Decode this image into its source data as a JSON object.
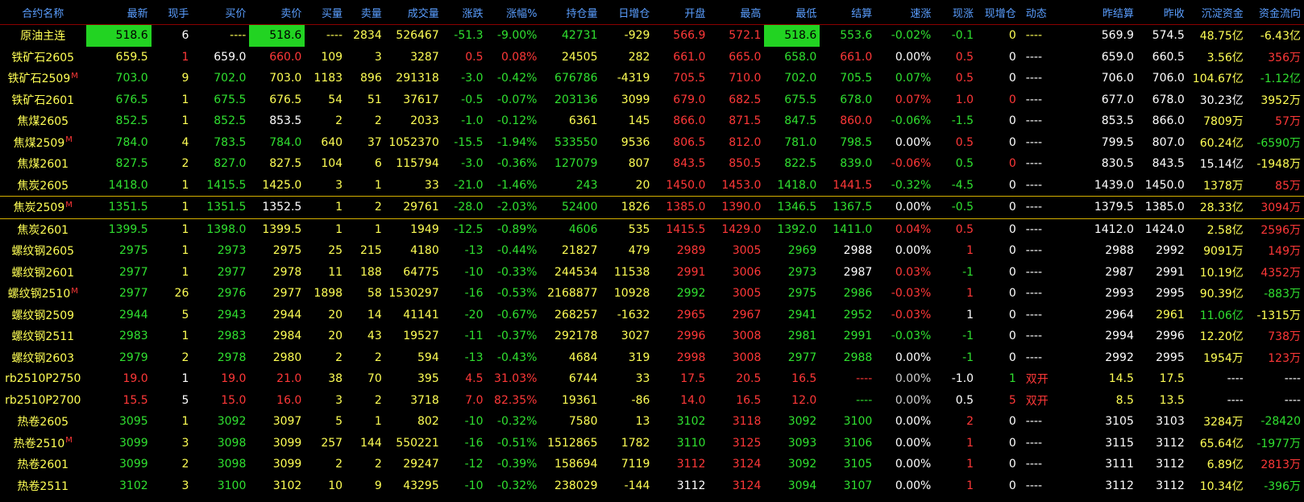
{
  "colors": {
    "header": "#5a9eff",
    "yellow": "#ffff55",
    "red": "#ff3838",
    "green": "#30e030",
    "white": "#ffffff",
    "highlight": "#22d322",
    "selected_border": "#d4b000"
  },
  "headers": [
    "合约名称",
    "最新",
    "现手",
    "买价",
    "卖价",
    "买量",
    "卖量",
    "成交量",
    "涨跌",
    "涨幅%",
    "持仓量",
    "日增仓",
    "开盘",
    "最高",
    "最低",
    "结算",
    "速涨",
    "现涨",
    "现增仓",
    "动态",
    "昨结算",
    "昨收",
    "沉淀资金",
    "资金流向"
  ],
  "rows": [
    {
      "cells": [
        "原油主连",
        "518.6",
        "6",
        "----",
        "518.6",
        "----",
        "2834",
        "526467",
        "-51.3",
        "-9.00%",
        "42731",
        "-929",
        "566.9",
        "572.1",
        "518.6",
        "553.6",
        "-0.02%",
        "-0.1",
        "0",
        "----",
        "569.9",
        "574.5",
        "48.75亿",
        "-6.43亿"
      ],
      "colors": "ywwyyyyygggyrrggggyywwyyg",
      "mark": "",
      "hl": [
        1,
        4,
        14
      ]
    },
    {
      "cells": [
        "铁矿石2605",
        "659.5",
        "1",
        "659.0",
        "660.0",
        "109",
        "3",
        "3287",
        "0.5",
        "0.08%",
        "24505",
        "282",
        "661.0",
        "665.0",
        "658.0",
        "661.0",
        "0.00%",
        "0.5",
        "0",
        "----",
        "659.0",
        "660.5",
        "3.56亿",
        "356万"
      ],
      "colors": "ryrwryyyrryyrrgrwrwwwwyr",
      "mark": "",
      "hl": []
    },
    {
      "cells": [
        "铁矿石2509",
        "703.0",
        "9",
        "702.0",
        "703.0",
        "1183",
        "896",
        "291318",
        "-3.0",
        "-0.42%",
        "676786",
        "-4319",
        "705.5",
        "710.0",
        "702.0",
        "705.5",
        "0.07%",
        "0.5",
        "0",
        "----",
        "706.0",
        "706.0",
        "104.67亿",
        "-1.12亿"
      ],
      "colors": "ygygyyyygggyrrgggrwwwwyg",
      "mark": "M",
      "hl": []
    },
    {
      "cells": [
        "铁矿石2601",
        "676.5",
        "1",
        "675.5",
        "676.5",
        "54",
        "51",
        "37617",
        "-0.5",
        "-0.07%",
        "203136",
        "3099",
        "679.0",
        "682.5",
        "675.5",
        "678.0",
        "0.07%",
        "1.0",
        "0",
        "----",
        "677.0",
        "678.0",
        "30.23亿",
        "3952万"
      ],
      "colors": "ygygyyyygggyrrggrrrwwwwyr",
      "mark": "",
      "hl": []
    },
    {
      "cells": [
        "焦煤2605",
        "852.5",
        "1",
        "852.5",
        "853.5",
        "2",
        "2",
        "2033",
        "-1.0",
        "-0.12%",
        "6361",
        "145",
        "866.0",
        "871.5",
        "847.5",
        "860.0",
        "-0.06%",
        "-1.5",
        "0",
        "----",
        "853.5",
        "866.0",
        "7809万",
        "57万"
      ],
      "colors": "ygygwyyyggyyrrgrggwwwwyr",
      "mark": "",
      "hl": []
    },
    {
      "cells": [
        "焦煤2509",
        "784.0",
        "4",
        "783.5",
        "784.0",
        "640",
        "37",
        "1052370",
        "-15.5",
        "-1.94%",
        "533550",
        "9536",
        "806.5",
        "812.0",
        "781.0",
        "798.5",
        "0.00%",
        "0.5",
        "0",
        "----",
        "799.5",
        "807.0",
        "60.24亿",
        "-6590万"
      ],
      "colors": "ygyggyyygggyrrggwrwwwwyg",
      "mark": "M",
      "hl": []
    },
    {
      "cells": [
        "焦煤2601",
        "827.5",
        "2",
        "827.0",
        "827.5",
        "104",
        "6",
        "115794",
        "-3.0",
        "-0.36%",
        "127079",
        "807",
        "843.5",
        "850.5",
        "822.5",
        "839.0",
        "-0.06%",
        "0.5",
        "0",
        "----",
        "830.5",
        "843.5",
        "15.14亿",
        "-1948万"
      ],
      "colors": "ygygyyyygggyrrggrgrwwwwyg",
      "mark": "",
      "hl": []
    },
    {
      "cells": [
        "焦炭2605",
        "1418.0",
        "1",
        "1415.5",
        "1425.0",
        "3",
        "1",
        "33",
        "-21.0",
        "-1.46%",
        "243",
        "20",
        "1450.0",
        "1453.0",
        "1418.0",
        "1441.5",
        "-0.32%",
        "-4.5",
        "0",
        "----",
        "1439.0",
        "1450.0",
        "1378万",
        "85万"
      ],
      "colors": "ygygyyyygggyrrgrggwwwwyr",
      "mark": "",
      "hl": []
    },
    {
      "cells": [
        "焦炭2509",
        "1351.5",
        "1",
        "1351.5",
        "1352.5",
        "1",
        "2",
        "29761",
        "-28.0",
        "-2.03%",
        "52400",
        "1826",
        "1385.0",
        "1390.0",
        "1346.5",
        "1367.5",
        "0.00%",
        "-0.5",
        "0",
        "----",
        "1379.5",
        "1385.0",
        "28.33亿",
        "3094万"
      ],
      "colors": "ygygwyyygggyrrggwgwwwwyr",
      "mark": "M",
      "hl": [],
      "selected": true
    },
    {
      "cells": [
        "焦炭2601",
        "1399.5",
        "1",
        "1398.0",
        "1399.5",
        "1",
        "1",
        "1949",
        "-12.5",
        "-0.89%",
        "4606",
        "535",
        "1415.5",
        "1429.0",
        "1392.0",
        "1411.0",
        "0.04%",
        "0.5",
        "0",
        "----",
        "1412.0",
        "1424.0",
        "2.58亿",
        "2596万"
      ],
      "colors": "ygygyyyygggyrrggrrwwwwyr",
      "mark": "",
      "hl": []
    },
    {
      "cells": [
        "螺纹钢2605",
        "2975",
        "1",
        "2973",
        "2975",
        "25",
        "215",
        "4180",
        "-13",
        "-0.44%",
        "21827",
        "479",
        "2989",
        "3005",
        "2969",
        "2988",
        "0.00%",
        "1",
        "0",
        "----",
        "2988",
        "2992",
        "9091万",
        "149万"
      ],
      "colors": "ygygyyyyggyyrrgwwrwwwwyr",
      "mark": "",
      "hl": []
    },
    {
      "cells": [
        "螺纹钢2601",
        "2977",
        "1",
        "2977",
        "2978",
        "11",
        "188",
        "64775",
        "-10",
        "-0.33%",
        "244534",
        "11538",
        "2991",
        "3006",
        "2973",
        "2987",
        "0.03%",
        "-1",
        "0",
        "----",
        "2987",
        "2991",
        "10.19亿",
        "4352万"
      ],
      "colors": "ygygyyyyggyyrrgwrgwwwwyr",
      "mark": "",
      "hl": []
    },
    {
      "cells": [
        "螺纹钢2510",
        "2977",
        "26",
        "2976",
        "2977",
        "1898",
        "58",
        "1530297",
        "-16",
        "-0.53%",
        "2168877",
        "10928",
        "2992",
        "3005",
        "2975",
        "2986",
        "-0.03%",
        "1",
        "0",
        "----",
        "2993",
        "2995",
        "90.39亿",
        "-883万"
      ],
      "colors": "ygygyyyyggyygrggrrwwwwyg",
      "mark": "M",
      "hl": []
    },
    {
      "cells": [
        "螺纹钢2509",
        "2944",
        "5",
        "2943",
        "2944",
        "20",
        "14",
        "41141",
        "-20",
        "-0.67%",
        "268257",
        "-1632",
        "2965",
        "2967",
        "2941",
        "2952",
        "-0.03%",
        "1",
        "0",
        "----",
        "2964",
        "2961",
        "11.06亿",
        "-1315万"
      ],
      "colors": "ygygyyyyggyyrrggrwwwwyg",
      "mark": "",
      "hl": []
    },
    {
      "cells": [
        "螺纹钢2511",
        "2983",
        "1",
        "2983",
        "2984",
        "20",
        "43",
        "19527",
        "-11",
        "-0.37%",
        "292178",
        "3027",
        "2996",
        "3008",
        "2981",
        "2991",
        "-0.03%",
        "-1",
        "0",
        "----",
        "2994",
        "2996",
        "12.20亿",
        "738万"
      ],
      "colors": "ygygyyyyggyyrrggggwwwwyr",
      "mark": "",
      "hl": []
    },
    {
      "cells": [
        "螺纹钢2603",
        "2979",
        "2",
        "2978",
        "2980",
        "2",
        "2",
        "594",
        "-13",
        "-0.43%",
        "4684",
        "319",
        "2998",
        "3008",
        "2977",
        "2988",
        "0.00%",
        "-1",
        "0",
        "----",
        "2992",
        "2995",
        "1954万",
        "123万"
      ],
      "colors": "ygygyyyyggyyrrggwgwwwwyr",
      "mark": "",
      "hl": []
    },
    {
      "cells": [
        "rb2510P2750",
        "19.0",
        "1",
        "19.0",
        "21.0",
        "38",
        "70",
        "395",
        "4.5",
        "31.03%",
        "6744",
        "33",
        "17.5",
        "20.5",
        "16.5",
        "----",
        "0.00%",
        "-1.0",
        "1",
        "双开",
        "14.5",
        "17.5",
        "----",
        "----"
      ],
      "colors": "nrwrryyyrryyrrrrnwgryywwyy",
      "mark": "",
      "hl": []
    },
    {
      "cells": [
        "rb2510P2700",
        "15.5",
        "5",
        "15.0",
        "16.0",
        "3",
        "2",
        "3718",
        "7.0",
        "82.35%",
        "19361",
        "-86",
        "14.0",
        "16.5",
        "12.0",
        "----",
        "0.00%",
        "0.5",
        "5",
        "双开",
        "8.5",
        "13.5",
        "----",
        "----"
      ],
      "colors": "nrwrryyyrryyrrrgnwrryywwyy",
      "mark": "",
      "hl": []
    },
    {
      "cells": [
        "热卷2605",
        "3095",
        "1",
        "3092",
        "3097",
        "5",
        "1",
        "802",
        "-10",
        "-0.32%",
        "7580",
        "13",
        "3102",
        "3118",
        "3092",
        "3100",
        "0.00%",
        "2",
        "0",
        "----",
        "3105",
        "3103",
        "3284万",
        "-28420"
      ],
      "colors": "ygygyyyyggyygrggwrwwwwyg",
      "mark": "",
      "hl": []
    },
    {
      "cells": [
        "热卷2510",
        "3099",
        "3",
        "3098",
        "3099",
        "257",
        "144",
        "550221",
        "-16",
        "-0.51%",
        "1512865",
        "1782",
        "3110",
        "3125",
        "3093",
        "3106",
        "0.00%",
        "1",
        "0",
        "----",
        "3115",
        "3112",
        "65.64亿",
        "-1977万"
      ],
      "colors": "ygygyyyyggyygrggwrwwwwyg",
      "mark": "M",
      "hl": []
    },
    {
      "cells": [
        "热卷2601",
        "3099",
        "2",
        "3098",
        "3099",
        "2",
        "2",
        "29247",
        "-12",
        "-0.39%",
        "158694",
        "7119",
        "3112",
        "3124",
        "3092",
        "3105",
        "0.00%",
        "1",
        "0",
        "----",
        "3111",
        "3112",
        "6.89亿",
        "2813万"
      ],
      "colors": "ygygyyyyggyyrrggwrwwwwyr",
      "mark": "",
      "hl": []
    },
    {
      "cells": [
        "热卷2511",
        "3102",
        "3",
        "3100",
        "3102",
        "10",
        "9",
        "43295",
        "-10",
        "-0.32%",
        "238029",
        "-144",
        "3112",
        "3124",
        "3094",
        "3107",
        "0.00%",
        "1",
        "0",
        "----",
        "3112",
        "3112",
        "10.34亿",
        "-396万"
      ],
      "colors": "ygygyyyyggyywrggwrwwwwyg",
      "mark": "",
      "hl": []
    }
  ]
}
